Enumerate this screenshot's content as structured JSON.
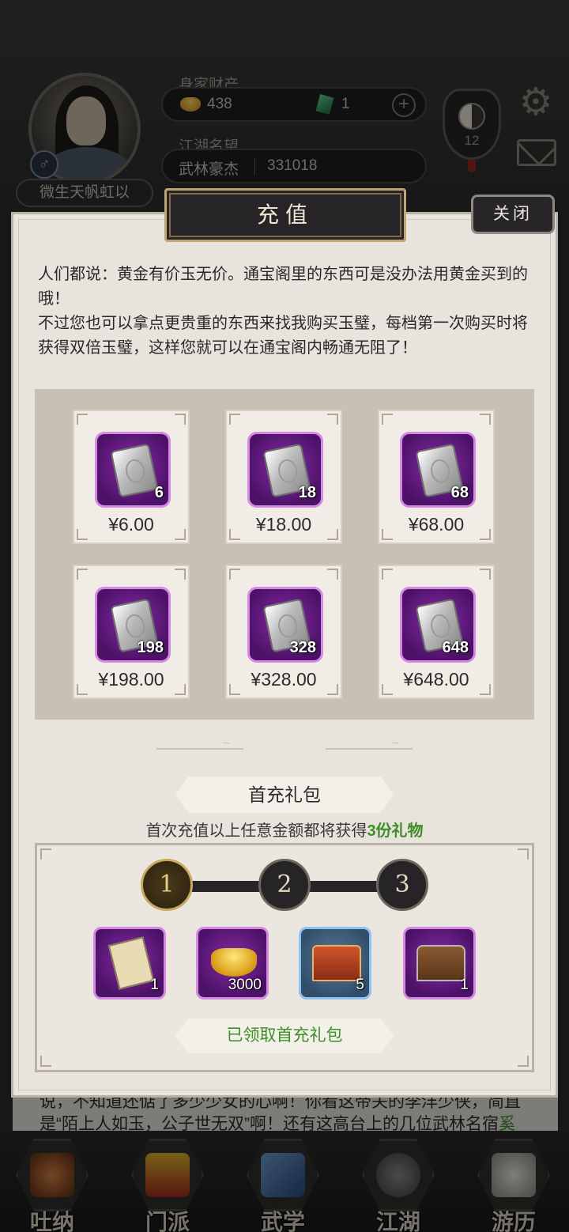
{
  "hud": {
    "wealth_label": "身家财产",
    "gold_amount": "438",
    "jade_amount": "1",
    "fame_label": "江湖名望",
    "fame_title": "武林豪杰",
    "fame_value": "331018",
    "player_name": "微生天帆虹以",
    "gender_symbol": "♂",
    "level": "12"
  },
  "dialog": {
    "title": "充值",
    "close_label": "关闭",
    "intro_line1": "人们都说：黄金有价玉无价。通宝阁里的东西可是没办法用黄金买到的哦！",
    "intro_line2": "不过您也可以拿点更贵重的东西来找我购买玉璧，每档第一次购买时将获得双倍玉璧，这样您就可以在通宝阁内畅通无阻了！",
    "packs": [
      {
        "qty": "6",
        "price": "¥6.00"
      },
      {
        "qty": "18",
        "price": "¥18.00"
      },
      {
        "qty": "68",
        "price": "¥68.00"
      },
      {
        "qty": "198",
        "price": "¥198.00"
      },
      {
        "qty": "328",
        "price": "¥328.00"
      },
      {
        "qty": "648",
        "price": "¥648.00"
      }
    ],
    "first_gift": {
      "title": "首充礼包",
      "desc_prefix": "首次充值以上任意金额都将获得",
      "desc_highlight": "3份礼物",
      "steps": [
        "1",
        "2",
        "3"
      ],
      "active_step": 1,
      "rewards": [
        {
          "icon": "secret-book",
          "qty": "1",
          "quality": "purple"
        },
        {
          "icon": "gold-ingot",
          "qty": "3000",
          "quality": "purple"
        },
        {
          "icon": "red-chest",
          "qty": "5",
          "quality": "blue"
        },
        {
          "icon": "treasure-chest",
          "qty": "1",
          "quality": "purple"
        }
      ],
      "claimed_label": "已领取首充礼包"
    }
  },
  "story": {
    "line1": "说，不知道还惦了多少少女的心啊！你看这帝关的李洋少侠，简直",
    "line2_prefix": "是“陌上人如玉，公子世无双”啊！还有这高台上的几位武林名宿",
    "line2_highlight": "奚"
  },
  "bottom_nav": [
    {
      "label": "吐纳",
      "icon": "meditation-icon"
    },
    {
      "label": "门派",
      "icon": "sect-banner-icon"
    },
    {
      "label": "武学",
      "icon": "martial-book-icon"
    },
    {
      "label": "江湖",
      "icon": "bamboo-hat-icon"
    },
    {
      "label": "游历",
      "icon": "horse-icon"
    }
  ],
  "colors": {
    "dialog_bg": "#e8e4dd",
    "gold_border": "#bfa573",
    "highlight_green": "#3e8d26",
    "purple_quality": "#d48ae0",
    "blue_quality": "#8fc2ee"
  }
}
